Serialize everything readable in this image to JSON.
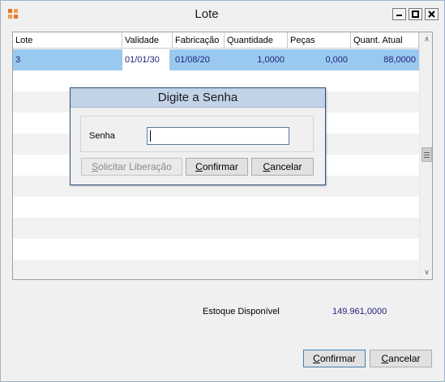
{
  "window": {
    "title": "Lote",
    "controls": {
      "minimize_icon": "minimize-icon",
      "maximize_icon": "maximize-icon",
      "close_icon": "close-icon"
    },
    "app_icon": "app-logo-icon"
  },
  "grid": {
    "columns": [
      "Lote",
      "Validade",
      "Fabricação",
      "Quantidade",
      "Peças",
      "Quant. Atual"
    ],
    "rows": [
      {
        "lote": "3",
        "validade": "01/01/30",
        "fabricacao": "01/08/20",
        "quantidade": "1,0000",
        "pecas": "0,000",
        "quant_atual": "88,0000",
        "selected": true
      }
    ]
  },
  "stock": {
    "label": "Estoque Disponível",
    "value": "149.961,0000"
  },
  "buttons": {
    "confirm": "Confirmar",
    "confirm_accel": "C",
    "confirm_rest": "onfirmar",
    "cancel_accel": "C",
    "cancel_rest": "ancelar"
  },
  "dialog": {
    "title": "Digite a Senha",
    "password_label": "Senha",
    "password_value": "",
    "request_button": "Solicitar Liberação",
    "request_accel": "S",
    "request_rest": "olicitar Liberação",
    "confirm_accel": "C",
    "confirm_rest": "onfirmar",
    "cancel_accel": "C",
    "cancel_rest": "ancelar"
  },
  "colors": {
    "selection": "#99c9ef",
    "dialog_title_bg": "#c2d3e8",
    "value_text": "#1f1f7a"
  }
}
